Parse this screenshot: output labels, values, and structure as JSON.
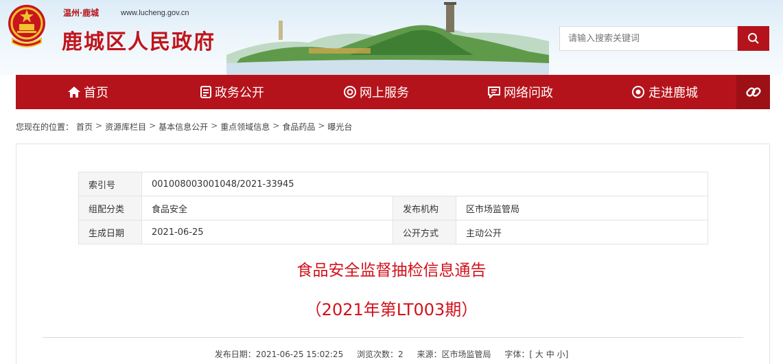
{
  "header": {
    "city": "温州·鹿城",
    "url": "www.lucheng.gov.cn",
    "title": "鹿城区人民政府"
  },
  "search": {
    "placeholder": "请输入搜索关键词"
  },
  "nav": {
    "items": [
      {
        "label": "首页",
        "icon": "home-icon"
      },
      {
        "label": "政务公开",
        "icon": "document-icon"
      },
      {
        "label": "网上服务",
        "icon": "service-icon"
      },
      {
        "label": "网络问政",
        "icon": "chat-icon"
      },
      {
        "label": "走进鹿城",
        "icon": "eye-icon"
      }
    ],
    "link_icon": "link-icon"
  },
  "breadcrumb": {
    "prefix": "您现在的位置：",
    "items": [
      "首页",
      "资源库栏目",
      "基本信息公开",
      "重点领域信息",
      "食品药品",
      "曝光台"
    ]
  },
  "meta": {
    "index_label": "索引号",
    "index_value": "001008003001048/2021-33945",
    "category_label": "组配分类",
    "category_value": "食品安全",
    "publisher_label": "发布机构",
    "publisher_value": "区市场监管局",
    "date_label": "生成日期",
    "date_value": "2021-06-25",
    "mode_label": "公开方式",
    "mode_value": "主动公开"
  },
  "doc": {
    "title": "食品安全监督抽检信息通告",
    "subtitle": "（2021年第LT003期）"
  },
  "pubinfo": {
    "date": "发布日期：2021-06-25 15:02:25",
    "views": "浏览次数：2",
    "source": "来源：区市场监管局",
    "font_label": "字体：[",
    "font_large": "大",
    "font_mid": "中",
    "font_small": "小",
    "font_close": "]"
  },
  "colors": {
    "brand_red": "#b5131b",
    "title_red": "#d0121b"
  }
}
